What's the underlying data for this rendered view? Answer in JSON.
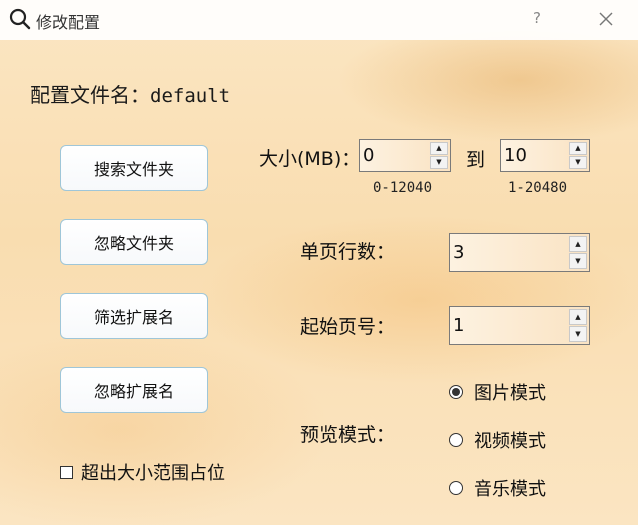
{
  "window": {
    "title": "修改配置",
    "help": "?"
  },
  "config": {
    "name_label": "配置文件名：",
    "name_value": "default"
  },
  "buttons": {
    "search_folder": "搜索文件夹",
    "ignore_folder": "忽略文件夹",
    "filter_ext": "筛选扩展名",
    "ignore_ext": "忽略扩展名"
  },
  "checkbox": {
    "label": "超出大小范围占位",
    "checked": false
  },
  "size": {
    "label": "大小(MB)：",
    "min_value": "0",
    "min_range": "0-12040",
    "to_label": "到",
    "max_value": "10",
    "max_range": "1-20480"
  },
  "rows_per_page": {
    "label": "单页行数：",
    "value": "3"
  },
  "start_page": {
    "label": "起始页号：",
    "value": "1"
  },
  "preview": {
    "label": "预览模式：",
    "options": [
      {
        "label": "图片模式",
        "selected": true
      },
      {
        "label": "视频模式",
        "selected": false
      },
      {
        "label": "音乐模式",
        "selected": false
      }
    ]
  },
  "icons": {
    "title": "search-icon",
    "close": "close-icon",
    "up": "caret-up-icon",
    "down": "caret-down-icon"
  }
}
